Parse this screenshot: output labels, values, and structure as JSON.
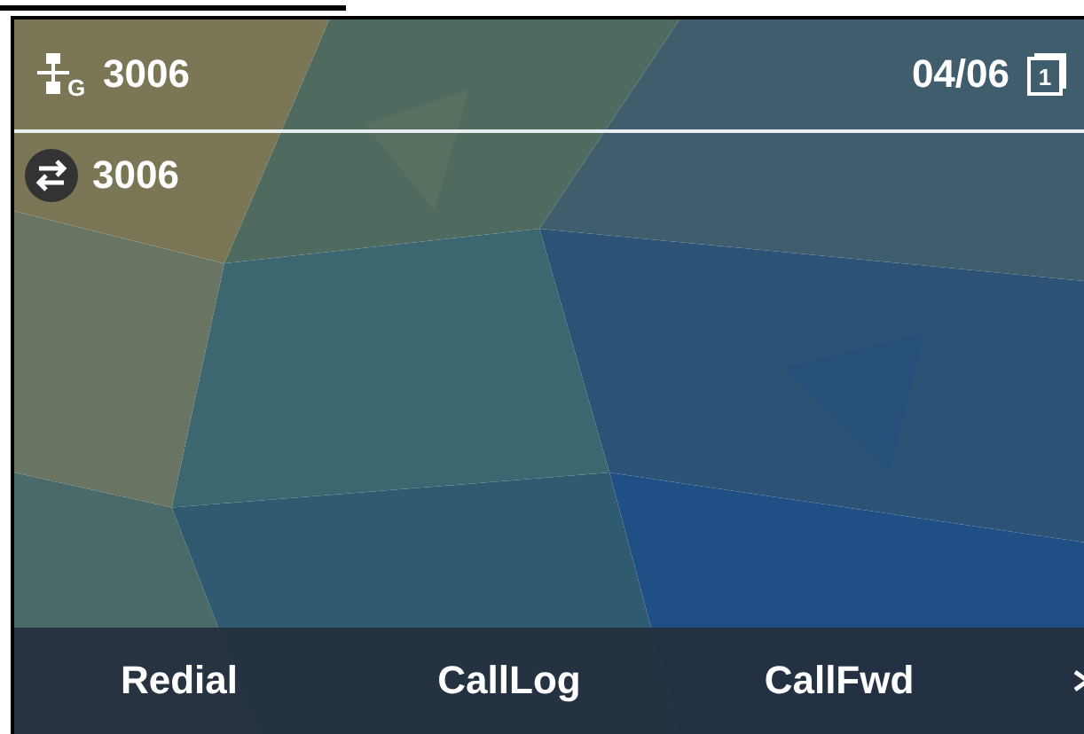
{
  "status_bar": {
    "network_label": "G",
    "account": "3006",
    "date": "04/06",
    "page_indicator": "1"
  },
  "lines": [
    {
      "label": "3006"
    }
  ],
  "softkeys": [
    {
      "label": "Redial"
    },
    {
      "label": "CallLog"
    },
    {
      "label": "CallFwd"
    }
  ]
}
